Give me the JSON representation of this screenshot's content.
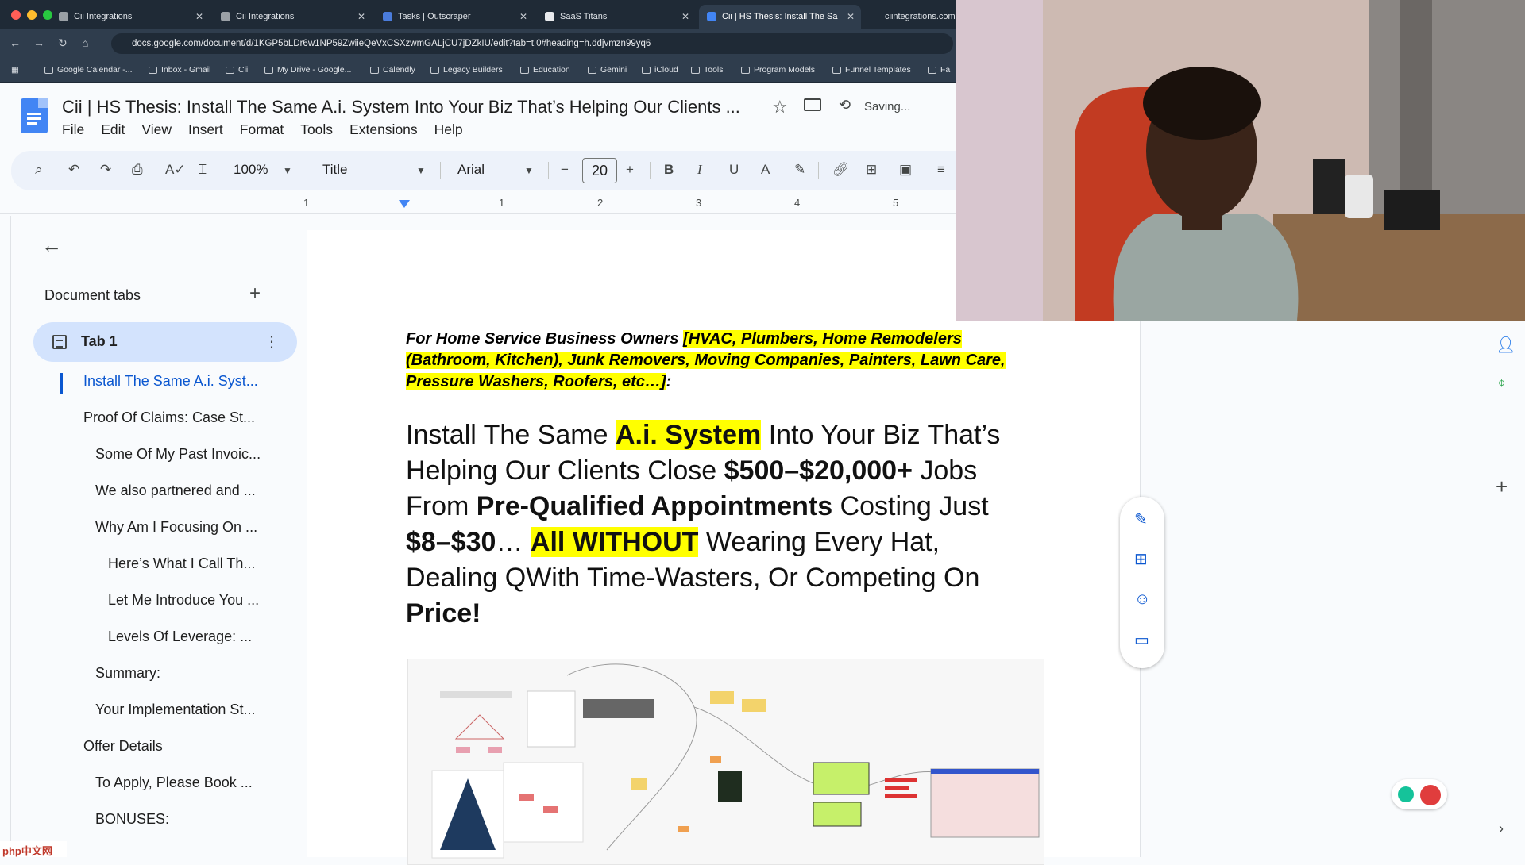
{
  "browser": {
    "tabs": [
      {
        "title": "Cii Integrations",
        "favicon_color": "#9aa0a6"
      },
      {
        "title": "Cii Integrations",
        "favicon_color": "#9aa0a6"
      },
      {
        "title": "Tasks | Outscraper",
        "favicon_color": "#4a7cdc"
      },
      {
        "title": "SaaS Titans",
        "favicon_color": "#e8eaed"
      },
      {
        "title": "Cii | HS Thesis: Install The Sa",
        "favicon_color": "#4285f4"
      },
      {
        "title": "ciintegrations.com",
        "favicon_color": "#9aa0a6"
      }
    ],
    "url": "docs.google.com/document/d/1KGP5bLDr6w1NP59ZwiieQeVxCSXzwmGALjCU7jDZkIU/edit?tab=t.0#heading=h.ddjvmzn99yq6",
    "bookmarks": [
      "Google Calendar -...",
      "Inbox - Gmail",
      "Cii",
      "My Drive - Google...",
      "Calendly",
      "Legacy Builders",
      "Education",
      "Gemini",
      "iCloud",
      "Tools",
      "Program Models",
      "Funnel Templates",
      "Fa"
    ]
  },
  "doc": {
    "title": "Cii | HS Thesis: Install The Same A.i. System Into Your Biz That’s Helping Our Clients ...",
    "saving": "Saving...",
    "menus": [
      "File",
      "Edit",
      "View",
      "Insert",
      "Format",
      "Tools",
      "Extensions",
      "Help"
    ]
  },
  "toolbar": {
    "zoom": "100%",
    "style": "Title",
    "font": "Arial",
    "font_size": "20"
  },
  "ruler": {
    "numbers": [
      "1",
      "1",
      "2",
      "3",
      "4",
      "5"
    ]
  },
  "sidebar": {
    "heading": "Document tabs",
    "tab_label": "Tab 1",
    "outline": [
      "Install The Same A.i. Syst...",
      "Proof Of Claims: Case St...",
      "Some Of My Past Invoic...",
      "We also partnered and ...",
      "Why Am I Focusing On ...",
      "Here’s What I Call Th...",
      "Let Me Introduce You ...",
      "Levels Of Leverage: ...",
      "Summary:",
      "Your Implementation St...",
      "Offer Details",
      "To Apply, Please Book ...",
      "BONUSES:"
    ]
  },
  "content": {
    "intro_plain": "For Home Service Business Owners ",
    "intro_highlight": "[HVAC, Plumbers, Home Remodelers (Bathroom, Kitchen), Junk Removers, Moving Companies, Painters, Lawn Care, Pressure Washers, Roofers, etc…]",
    "intro_end": ":",
    "h1": "Install The Same ",
    "h2": "A.i. System",
    "h3": " Into Your Biz That’s Helping Our Clients Close ",
    "h4": "$500–$20,000+",
    "h5": " Jobs From ",
    "h6": "Pre-Qualified Appointments",
    "h7": " Costing Just ",
    "h8": "$8–$30",
    "h9": "… ",
    "h10": "All WITHOUT",
    "h11": " Wearing Every Hat, Dealing QWith Time-Wasters, Or Competing On ",
    "h12": "Price!"
  },
  "watermark": "php中文网",
  "colors": {
    "highlight": "#ffff00",
    "accent": "#0b57d0",
    "tab_active_bg": "#d3e3fd"
  }
}
